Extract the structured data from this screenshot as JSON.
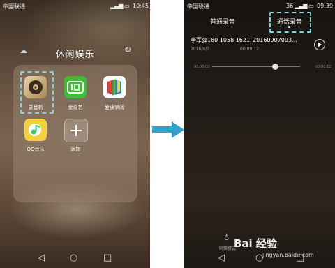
{
  "left_screen": {
    "status": {
      "carrier": "中国联通",
      "time": "10:45"
    },
    "folder_title": "休闲娱乐",
    "apps": [
      {
        "label": "录音机",
        "icon": "recorder-icon",
        "highlighted": true
      },
      {
        "label": "爱奇艺",
        "icon": "iqiyi-icon"
      },
      {
        "label": "爱读掌阅",
        "icon": "ireader-icon"
      },
      {
        "label": "QQ音乐",
        "icon": "qq-music-icon"
      },
      {
        "label": "添加",
        "icon": "add-icon"
      }
    ],
    "nav": {
      "back": "◁",
      "home": "○",
      "recents": "□"
    }
  },
  "right_screen": {
    "status": {
      "carrier": "中国联通",
      "network": "36",
      "battery": "",
      "time": "09:39"
    },
    "tabs": {
      "normal": "普通录音",
      "call": "通话录音"
    },
    "recording": {
      "title": "李军@180 1058 1621_20160907093...",
      "date": "2016/9/7",
      "duration": "00:00:12",
      "time_start": "00:00:00",
      "time_end": "00:00:12",
      "progress": 0.72
    },
    "earpiece_label": "听筒模式",
    "nav": {
      "back": "◁",
      "home": "○",
      "recents": "□"
    }
  },
  "watermark": {
    "text": "Bai 经验",
    "url": "jingyan.baidu.com"
  },
  "colors": {
    "accent": "#2ea2c9",
    "highlight": "#7ad3d8"
  }
}
